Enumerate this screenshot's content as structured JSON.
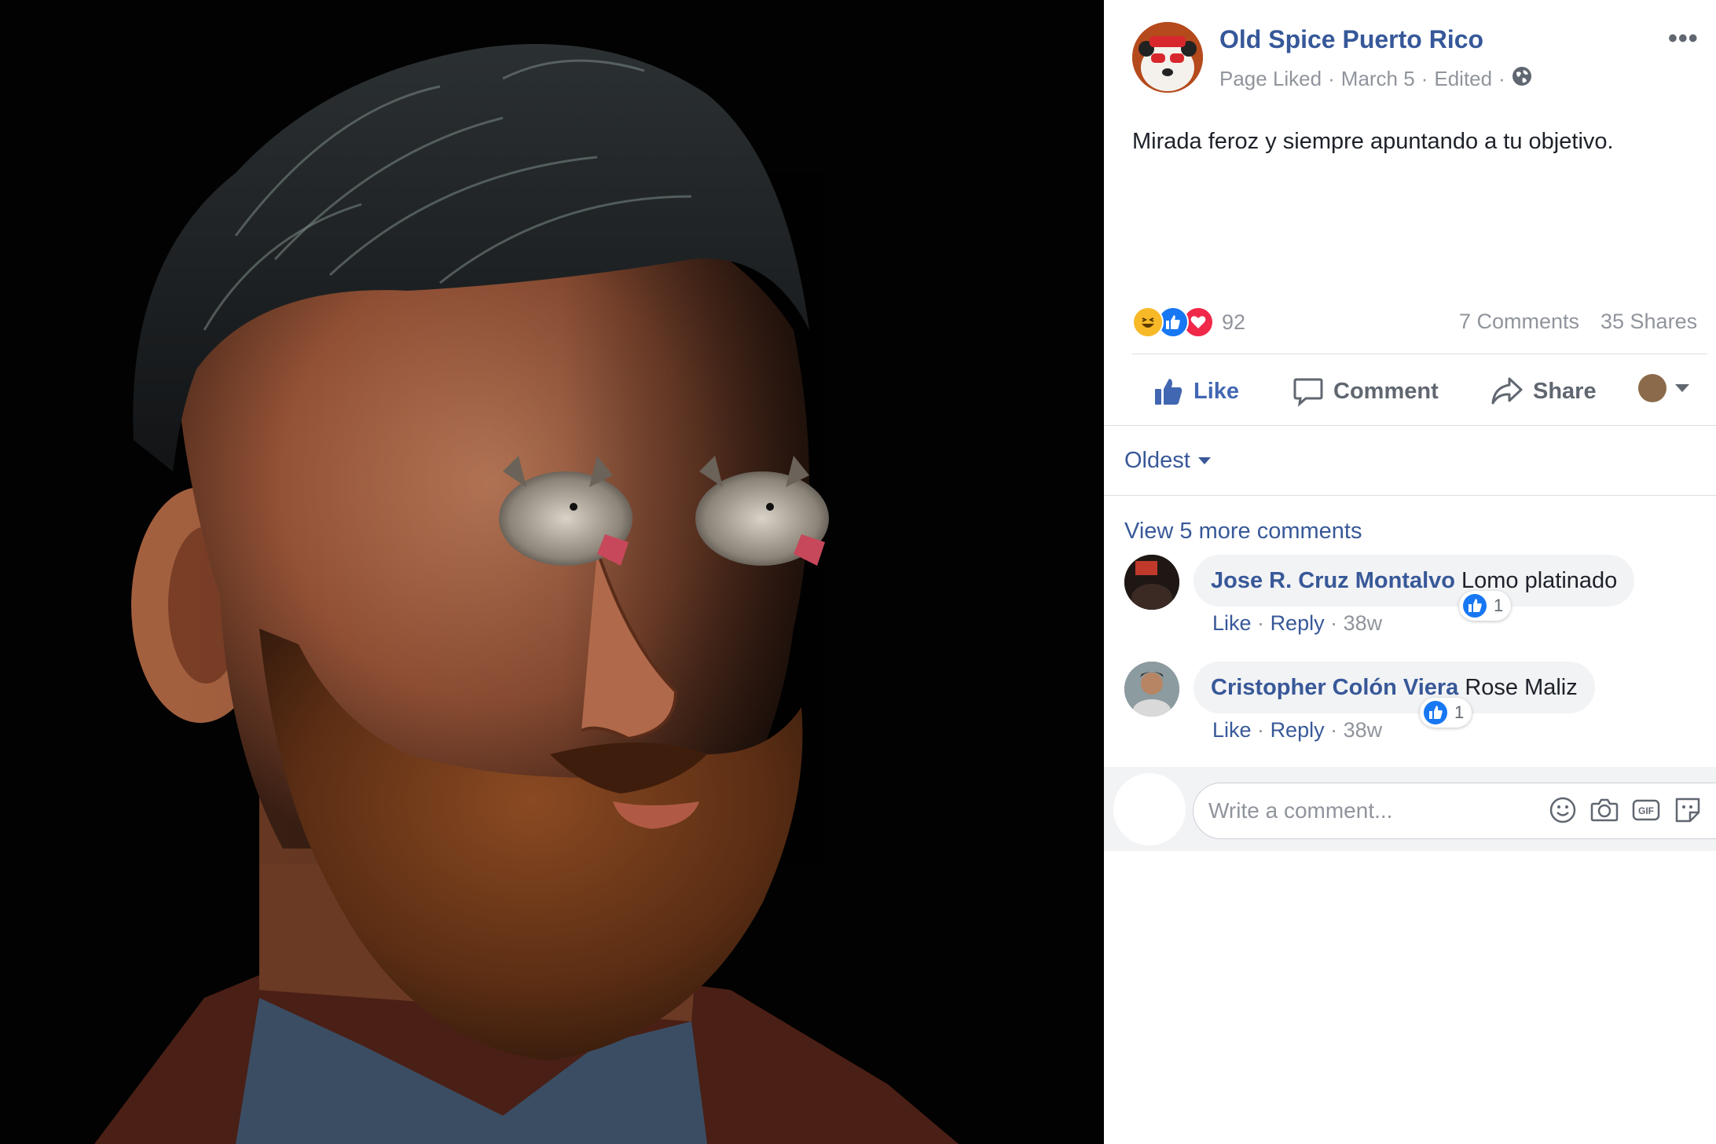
{
  "post": {
    "page_name": "Old Spice Puerto Rico",
    "meta": {
      "liked": "Page Liked",
      "sep": "·",
      "date": "March 5",
      "edited": "Edited",
      "privacy_icon": "globe-icon"
    },
    "more_label": "•••",
    "text": "Mirada feroz y siempre apuntando a tu objetivo.",
    "reaction_icons": [
      "haha-icon",
      "like-icon",
      "love-icon"
    ],
    "reaction_count": "92",
    "comments_count": "7 Comments",
    "shares_count": "35 Shares"
  },
  "actions": {
    "like": "Like",
    "comment": "Comment",
    "share": "Share"
  },
  "comments_section": {
    "sort_label": "Oldest",
    "view_more": "View 5 more comments",
    "comments": [
      {
        "author": "Jose R. Cruz Montalvo",
        "text": "Lomo platinado",
        "like": "Like",
        "reply": "Reply",
        "sep": "·",
        "time": "38w",
        "likes": "1"
      },
      {
        "author": "Cristopher Colón Viera",
        "text": "Rose Maliz",
        "like": "Like",
        "reply": "Reply",
        "sep": "·",
        "time": "38w",
        "likes": "1"
      }
    ],
    "composer_placeholder": "Write a comment...",
    "composer_icons": [
      "emoji-icon",
      "camera-icon",
      "gif-icon",
      "sticker-icon"
    ]
  },
  "colors": {
    "link_blue": "#385898",
    "like_blue": "#4267b2",
    "muted_gray": "#90949c",
    "love_red": "#f0284a",
    "haha_yellow": "#f7b928"
  }
}
